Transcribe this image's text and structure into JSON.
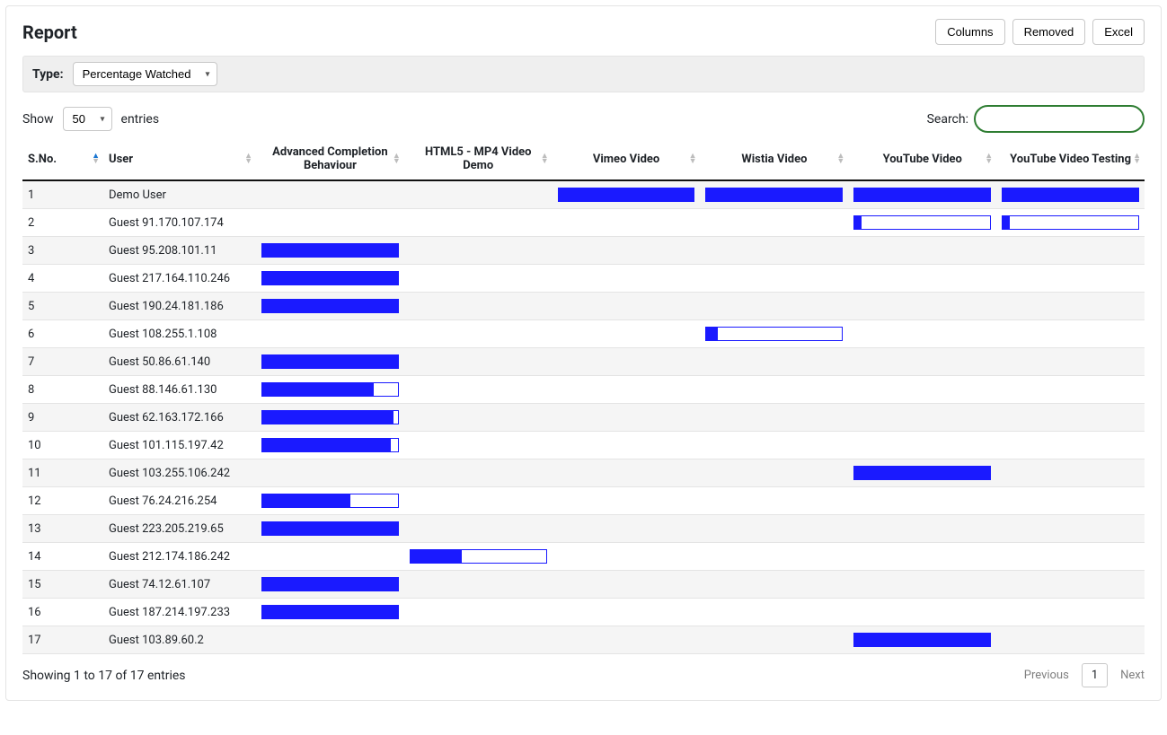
{
  "title": "Report",
  "buttons": {
    "columns": "Columns",
    "removed": "Removed",
    "excel": "Excel"
  },
  "typeBar": {
    "label": "Type:",
    "selected": "Percentage Watched"
  },
  "length": {
    "show": "Show",
    "value": "50",
    "entries": "entries"
  },
  "search": {
    "label": "Search:",
    "value": ""
  },
  "columns": [
    {
      "key": "sno",
      "label": "S.No.",
      "sorted": "asc"
    },
    {
      "key": "user",
      "label": "User",
      "sorted": null
    },
    {
      "key": "adv",
      "label": "Advanced Completion Behaviour",
      "sorted": null
    },
    {
      "key": "mp4",
      "label": "HTML5 - MP4 Video Demo",
      "sorted": null
    },
    {
      "key": "vimeo",
      "label": "Vimeo Video",
      "sorted": null
    },
    {
      "key": "wistia",
      "label": "Wistia Video",
      "sorted": null
    },
    {
      "key": "youtube",
      "label": "YouTube Video",
      "sorted": null
    },
    {
      "key": "yttest",
      "label": "YouTube Video Testing",
      "sorted": null
    }
  ],
  "rows": [
    {
      "sno": "1",
      "user": "Demo User",
      "adv": null,
      "mp4": null,
      "vimeo": 100,
      "wistia": 100,
      "youtube": 100,
      "yttest": 100
    },
    {
      "sno": "2",
      "user": "Guest 91.170.107.174",
      "adv": null,
      "mp4": null,
      "vimeo": null,
      "wistia": null,
      "youtube": 5,
      "yttest": 5
    },
    {
      "sno": "3",
      "user": "Guest 95.208.101.11",
      "adv": 100,
      "mp4": null,
      "vimeo": null,
      "wistia": null,
      "youtube": null,
      "yttest": null
    },
    {
      "sno": "4",
      "user": "Guest 217.164.110.246",
      "adv": 100,
      "mp4": null,
      "vimeo": null,
      "wistia": null,
      "youtube": null,
      "yttest": null
    },
    {
      "sno": "5",
      "user": "Guest 190.24.181.186",
      "adv": 100,
      "mp4": null,
      "vimeo": null,
      "wistia": null,
      "youtube": null,
      "yttest": null
    },
    {
      "sno": "6",
      "user": "Guest 108.255.1.108",
      "adv": null,
      "mp4": null,
      "vimeo": null,
      "wistia": 8,
      "youtube": null,
      "yttest": null
    },
    {
      "sno": "7",
      "user": "Guest 50.86.61.140",
      "adv": 100,
      "mp4": null,
      "vimeo": null,
      "wistia": null,
      "youtube": null,
      "yttest": null
    },
    {
      "sno": "8",
      "user": "Guest 88.146.61.130",
      "adv": 82,
      "mp4": null,
      "vimeo": null,
      "wistia": null,
      "youtube": null,
      "yttest": null
    },
    {
      "sno": "9",
      "user": "Guest 62.163.172.166",
      "adv": 97,
      "mp4": null,
      "vimeo": null,
      "wistia": null,
      "youtube": null,
      "yttest": null
    },
    {
      "sno": "10",
      "user": "Guest 101.115.197.42",
      "adv": 95,
      "mp4": null,
      "vimeo": null,
      "wistia": null,
      "youtube": null,
      "yttest": null
    },
    {
      "sno": "11",
      "user": "Guest 103.255.106.242",
      "adv": null,
      "mp4": null,
      "vimeo": null,
      "wistia": null,
      "youtube": 100,
      "yttest": null
    },
    {
      "sno": "12",
      "user": "Guest 76.24.216.254",
      "adv": 65,
      "mp4": null,
      "vimeo": null,
      "wistia": null,
      "youtube": null,
      "yttest": null
    },
    {
      "sno": "13",
      "user": "Guest 223.205.219.65",
      "adv": 100,
      "mp4": null,
      "vimeo": null,
      "wistia": null,
      "youtube": null,
      "yttest": null
    },
    {
      "sno": "14",
      "user": "Guest 212.174.186.242",
      "adv": null,
      "mp4": 38,
      "vimeo": null,
      "wistia": null,
      "youtube": null,
      "yttest": null
    },
    {
      "sno": "15",
      "user": "Guest 74.12.61.107",
      "adv": 100,
      "mp4": null,
      "vimeo": null,
      "wistia": null,
      "youtube": null,
      "yttest": null
    },
    {
      "sno": "16",
      "user": "Guest 187.214.197.233",
      "adv": 100,
      "mp4": null,
      "vimeo": null,
      "wistia": null,
      "youtube": null,
      "yttest": null
    },
    {
      "sno": "17",
      "user": "Guest 103.89.60.2",
      "adv": null,
      "mp4": null,
      "vimeo": null,
      "wistia": null,
      "youtube": 100,
      "yttest": null
    }
  ],
  "footer": {
    "info": "Showing 1 to 17 of 17 entries",
    "previous": "Previous",
    "page": "1",
    "next": "Next"
  }
}
